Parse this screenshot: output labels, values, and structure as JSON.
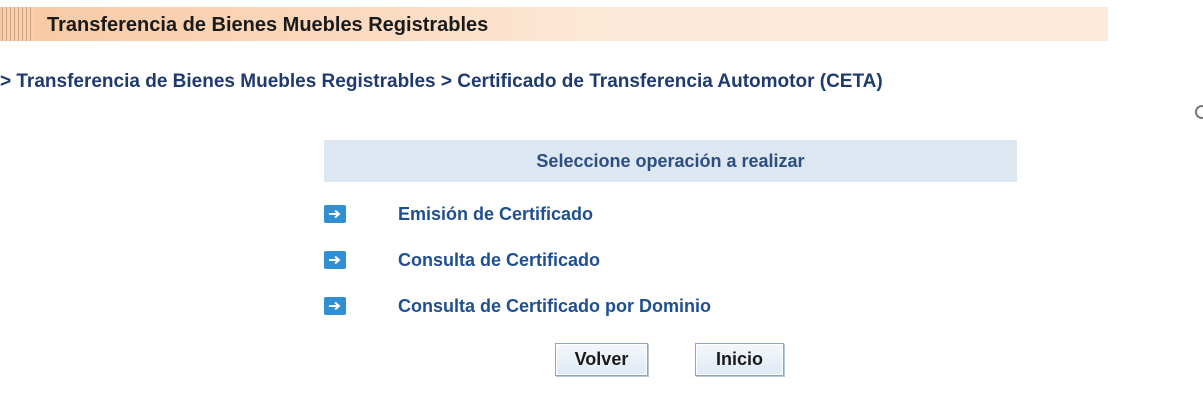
{
  "header": {
    "title": "Transferencia de Bienes Muebles Registrables"
  },
  "breadcrumb": {
    "separator1": "> ",
    "item1": "Transferencia de Bienes Muebles Registrables",
    "separator2": " > ",
    "item2": "Certificado de Transferencia Automotor (CETA)"
  },
  "panel": {
    "title": "Seleccione operación a realizar",
    "options": [
      {
        "label": "Emisión de Certificado",
        "icon": "arrow-right-icon"
      },
      {
        "label": "Consulta de Certificado",
        "icon": "arrow-right-icon"
      },
      {
        "label": "Consulta de Certificado por Dominio",
        "icon": "arrow-right-icon"
      }
    ]
  },
  "buttons": {
    "back": "Volver",
    "home": "Inicio"
  },
  "colors": {
    "header_bg": "#f8c9a2",
    "breadcrumb_text": "#1f3b6e",
    "panel_header_bg": "#dce7f2",
    "link_text": "#1f4e91",
    "arrow_icon_bg": "#2f8fd2"
  }
}
